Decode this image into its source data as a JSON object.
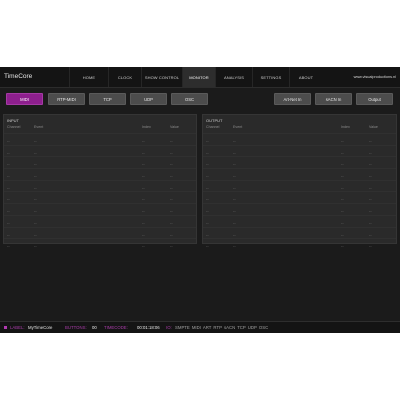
{
  "app": {
    "title": "TimeCore",
    "url": "www.visualproductions.nl"
  },
  "nav": [
    {
      "label": "HOME"
    },
    {
      "label": "CLOCK"
    },
    {
      "label": "SHOW CONTROL"
    },
    {
      "label": "MONITOR",
      "active": true
    },
    {
      "label": "ANALYSIS"
    },
    {
      "label": "SETTINGS"
    },
    {
      "label": "ABOUT"
    }
  ],
  "protocols_left": [
    "MIDI",
    "RTP-MIDI",
    "TCP",
    "UDP",
    "OSC"
  ],
  "protocols_right": [
    "Art-Net In",
    "sACN In",
    "Output"
  ],
  "active_protocol": "MIDI",
  "input_panel": {
    "title": "INPUT",
    "columns": [
      "Channel",
      "Event",
      "Index",
      "Value"
    ],
    "placeholder": "--",
    "row_count": 10
  },
  "output_panel": {
    "title": "OUTPUT",
    "columns": [
      "Channel",
      "Event",
      "Index",
      "Value"
    ],
    "placeholder": "--",
    "row_count": 10
  },
  "status": {
    "label_key": "LABEL:",
    "label_value": "MyTimeCore",
    "buttons_key": "BUTTONS:",
    "buttons_value": "00",
    "timecode_key": "TIMECODE:",
    "timecode_value": "00:01:18:06",
    "io_key": "IO:",
    "io_items": [
      "SMPTE",
      "MIDI",
      "ART",
      "RTP",
      "sACN",
      "TCP",
      "UDP",
      "OSC"
    ]
  },
  "colors": {
    "accent": "#8e1f8e",
    "background": "#1b1b1b",
    "panel": "#2a2a2a"
  }
}
